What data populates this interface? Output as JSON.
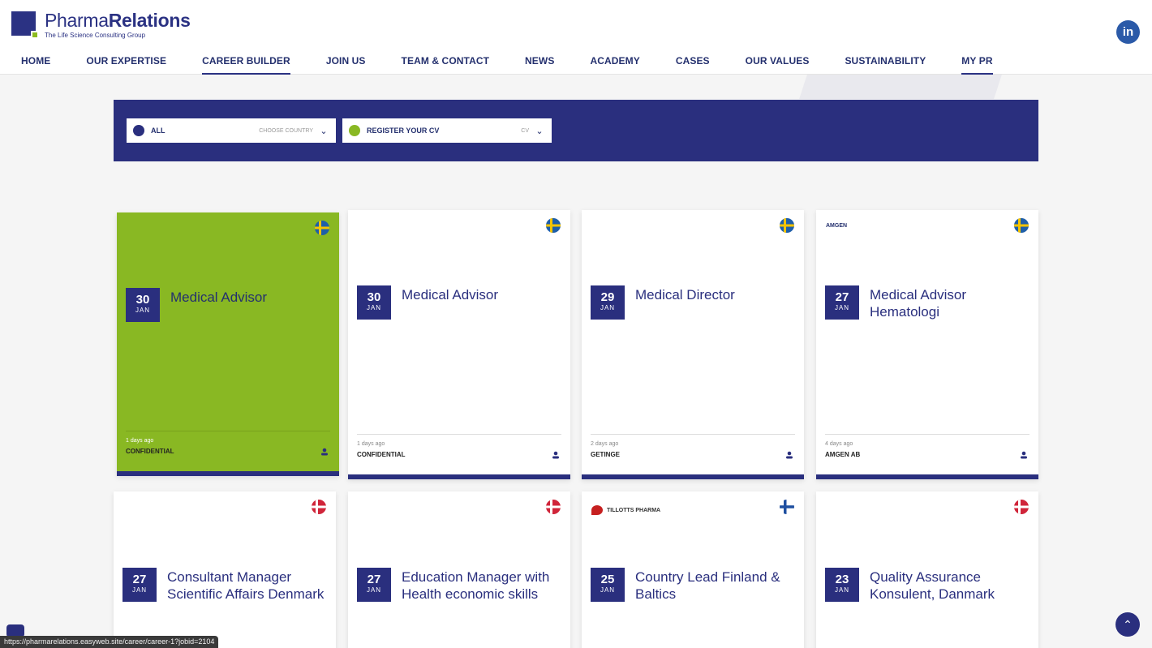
{
  "brand": {
    "name_light": "Pharma",
    "name_bold": "Relations",
    "tagline": "The Life Science Consulting Group",
    "colors": {
      "navy": "#2a2f7e",
      "green": "#89b823"
    }
  },
  "social": {
    "linkedin_label": "in"
  },
  "nav": [
    {
      "label": "HOME",
      "active": false
    },
    {
      "label": "OUR EXPERTISE",
      "active": false
    },
    {
      "label": "CAREER BUILDER",
      "active": true
    },
    {
      "label": "JOIN US",
      "active": false
    },
    {
      "label": "TEAM & CONTACT",
      "active": false
    },
    {
      "label": "NEWS",
      "active": false
    },
    {
      "label": "ACADEMY",
      "active": false
    },
    {
      "label": "CASES",
      "active": false
    },
    {
      "label": "OUR VALUES",
      "active": false
    },
    {
      "label": "SUSTAINABILITY",
      "active": false
    },
    {
      "label": "MY PR",
      "active": true
    }
  ],
  "filters": {
    "country": {
      "value": "ALL",
      "placeholder": "CHOOSE COUNTRY",
      "dot_color": "#2a2f7e"
    },
    "cv": {
      "value": "REGISTER YOUR CV",
      "placeholder": "CV",
      "dot_color": "#89b823"
    }
  },
  "jobs": [
    {
      "day": "30",
      "month": "JAN",
      "title": "Medical Advisor",
      "ago": "1 days ago",
      "company": "CONFIDENTIAL",
      "flag": "sweden",
      "company_logo": "",
      "highlighted": true
    },
    {
      "day": "30",
      "month": "JAN",
      "title": "Medical Advisor",
      "ago": "1 days ago",
      "company": "CONFIDENTIAL",
      "flag": "sweden",
      "company_logo": "",
      "highlighted": false
    },
    {
      "day": "29",
      "month": "JAN",
      "title": "Medical Director",
      "ago": "2 days ago",
      "company": "GETINGE",
      "flag": "sweden",
      "company_logo": "",
      "highlighted": false
    },
    {
      "day": "27",
      "month": "JAN",
      "title": "Medical Advisor Hematologi",
      "ago": "4 days ago",
      "company": "AMGEN AB",
      "flag": "sweden",
      "company_logo": "AMGEN",
      "highlighted": false
    },
    {
      "day": "27",
      "month": "JAN",
      "title": "Consultant Manager Scientific Affairs Denmark",
      "ago": "",
      "company": "",
      "flag": "denmark",
      "company_logo": "",
      "highlighted": false
    },
    {
      "day": "27",
      "month": "JAN",
      "title": "Education Manager with Health economic skills",
      "ago": "",
      "company": "",
      "flag": "denmark",
      "company_logo": "",
      "highlighted": false
    },
    {
      "day": "25",
      "month": "JAN",
      "title": "Country Lead Finland & Baltics",
      "ago": "",
      "company": "",
      "flag": "finland",
      "company_logo": "TILLOTTS PHARMA",
      "highlighted": false
    },
    {
      "day": "23",
      "month": "JAN",
      "title": "Quality Assurance Konsulent, Danmark",
      "ago": "",
      "company": "",
      "flag": "denmark",
      "company_logo": "",
      "highlighted": false
    }
  ],
  "status_url": "https://pharmarelations.easyweb.site/career/career-1?jobid=2104"
}
